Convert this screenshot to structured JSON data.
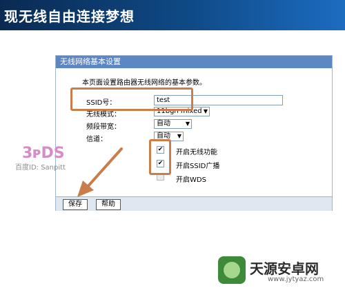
{
  "banner": {
    "title": "现无线自由连接梦想"
  },
  "panel": {
    "title": "无线网络基本设置",
    "description": "本页面设置路由器无线网络的基本参数。",
    "fields": {
      "ssid_label": "SSID号：",
      "ssid_value": "test",
      "mode_label": "无线模式：",
      "mode_value": "11bgn mixed",
      "bandwidth_label": "频段带宽：",
      "bandwidth_value": "自动",
      "channel_label": "信道：",
      "channel_value": "自动"
    },
    "checks": {
      "wireless_label": "开启无线功能",
      "broadcast_label": "开启SSID广播",
      "wds_label": "开启WDS"
    },
    "buttons": {
      "save": "保存",
      "help": "帮助"
    }
  },
  "watermark": {
    "caption": "百度ID: Sanpitt"
  },
  "brand": {
    "name": "天源安卓网",
    "url": "www.jytyaz.com"
  }
}
